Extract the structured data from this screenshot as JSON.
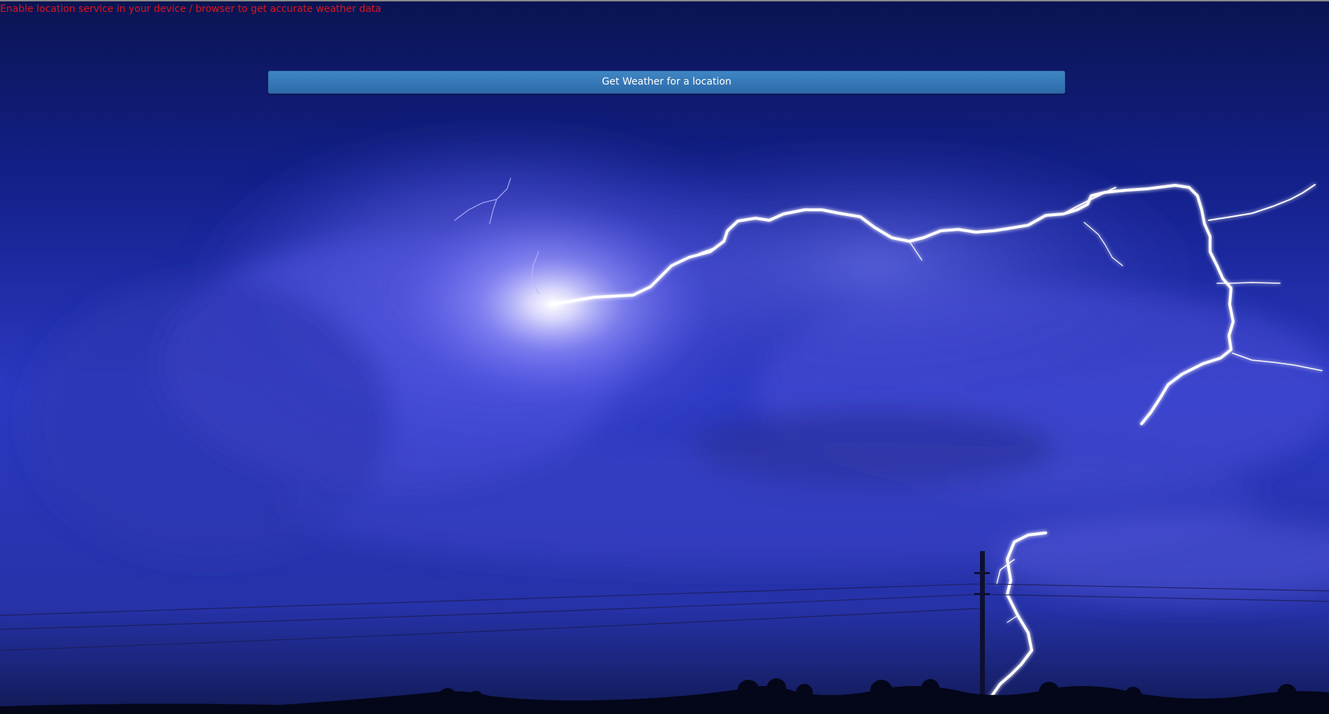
{
  "alert": {
    "location_warning": "Enable location service in your device / browser to get accurate weather data"
  },
  "actions": {
    "get_weather_label": "Get Weather for a location"
  },
  "background": {
    "scene": "lightning storm clouds at night",
    "colors": {
      "sky_dark": "#0b1550",
      "sky_mid": "#2d3fc4",
      "cloud_light": "#8a8eff",
      "lightning": "#ffffff",
      "ground": "#050a1c"
    }
  },
  "colors": {
    "warning_text": "#e0141e",
    "button_bg": "#3577b6",
    "button_text": "#ffffff"
  }
}
